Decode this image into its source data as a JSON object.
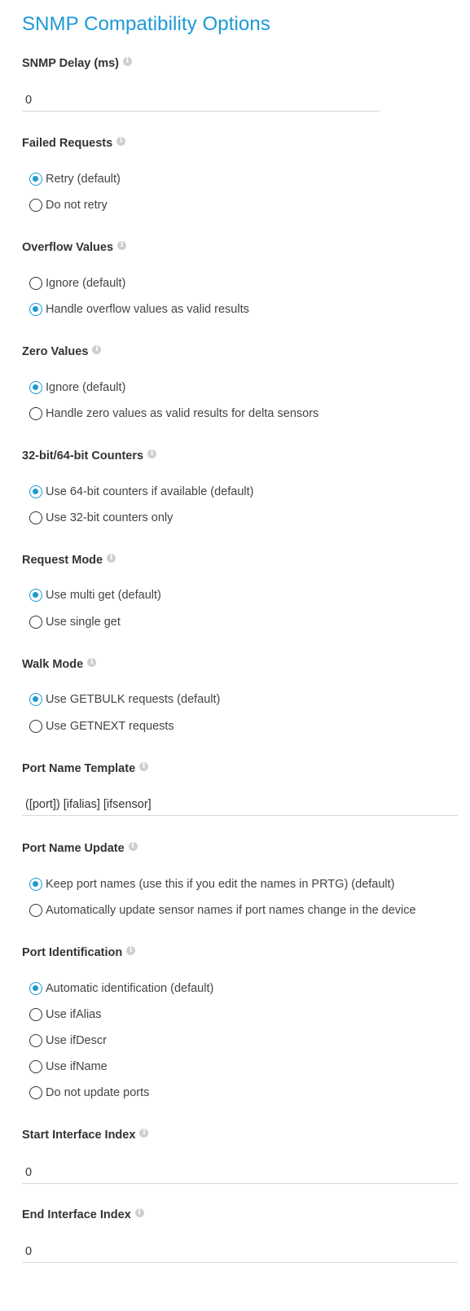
{
  "page_title": "SNMP Compatibility Options",
  "snmp_delay": {
    "label": "SNMP Delay (ms)",
    "value": "0"
  },
  "failed_requests": {
    "label": "Failed Requests",
    "options": [
      "Retry (default)",
      "Do not retry"
    ],
    "selected_index": 0
  },
  "overflow_values": {
    "label": "Overflow Values",
    "options": [
      "Ignore (default)",
      "Handle overflow values as valid results"
    ],
    "selected_index": 1
  },
  "zero_values": {
    "label": "Zero Values",
    "options": [
      "Ignore (default)",
      "Handle zero values as valid results for delta sensors"
    ],
    "selected_index": 0
  },
  "counters": {
    "label": "32-bit/64-bit Counters",
    "options": [
      "Use 64-bit counters if available (default)",
      "Use 32-bit counters only"
    ],
    "selected_index": 0
  },
  "request_mode": {
    "label": "Request Mode",
    "options": [
      "Use multi get (default)",
      "Use single get"
    ],
    "selected_index": 0
  },
  "walk_mode": {
    "label": "Walk Mode",
    "options": [
      "Use GETBULK requests (default)",
      "Use GETNEXT requests"
    ],
    "selected_index": 0
  },
  "port_name_template": {
    "label": "Port Name Template",
    "value": "([port]) [ifalias] [ifsensor]"
  },
  "port_name_update": {
    "label": "Port Name Update",
    "options": [
      "Keep port names (use this if you edit the names in PRTG) (default)",
      "Automatically update sensor names if port names change in the device"
    ],
    "selected_index": 0
  },
  "port_identification": {
    "label": "Port Identification",
    "options": [
      "Automatic identification (default)",
      "Use ifAlias",
      "Use ifDescr",
      "Use ifName",
      "Do not update ports"
    ],
    "selected_index": 0
  },
  "start_interface_index": {
    "label": "Start Interface Index",
    "value": "0"
  },
  "end_interface_index": {
    "label": "End Interface Index",
    "value": "0"
  },
  "info_icon": "info-icon",
  "colors": {
    "accent": "#1b9ad6",
    "text": "#333333",
    "divider": "#d9d9d9"
  }
}
